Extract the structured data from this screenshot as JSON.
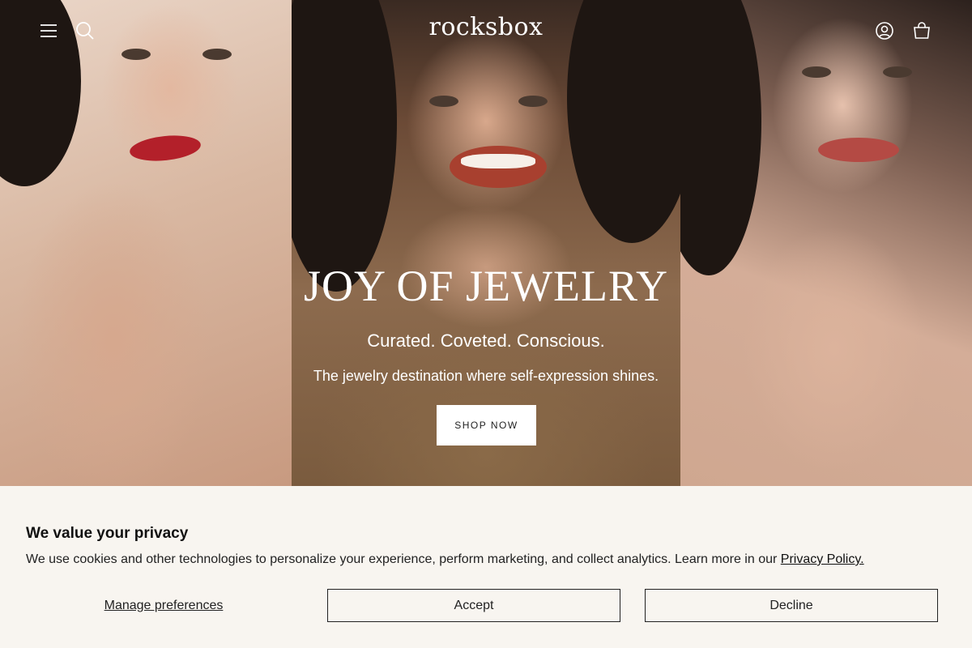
{
  "header": {
    "logo": "rocksbox",
    "icons": [
      "menu-icon",
      "search-icon",
      "account-icon",
      "cart-icon"
    ]
  },
  "hero": {
    "title": "JOY OF JEWELRY",
    "subtitle": "Curated. Coveted. Conscious.",
    "tagline": "The jewelry destination where self-expression shines.",
    "cta_label": "SHOP NOW"
  },
  "cookie_banner": {
    "title": "We value your privacy",
    "text": "We use cookies and other technologies to personalize your experience, perform marketing, and collect analytics. Learn more in our",
    "link_label": "Privacy Policy.",
    "manage_label": "Manage preferences",
    "accept_label": "Accept",
    "decline_label": "Decline"
  },
  "colors": {
    "background": "#f8f5f0",
    "text": "#222222",
    "hero_text": "#ffffff"
  }
}
